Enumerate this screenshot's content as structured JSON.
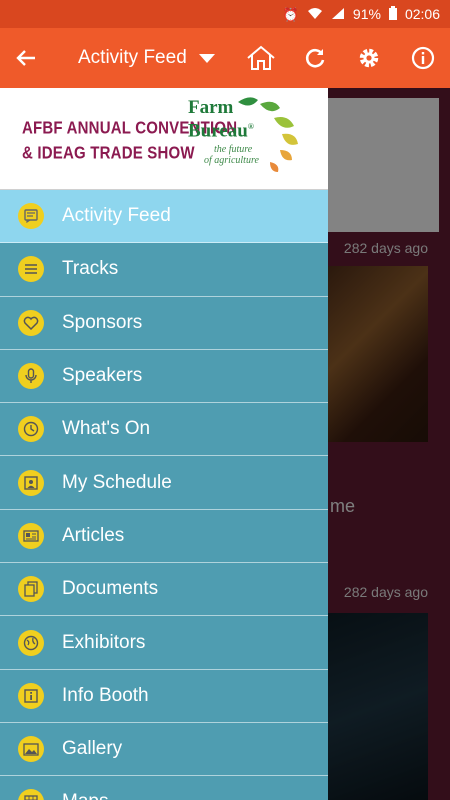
{
  "status_bar": {
    "battery": "91%",
    "time": "02:06"
  },
  "app_bar": {
    "title": "Activity Feed",
    "icons": [
      "back-arrow-icon",
      "dropdown-caret-icon",
      "home-icon",
      "refresh-icon",
      "gear-icon",
      "info-icon"
    ]
  },
  "drawer_header": {
    "convention_line1": "AFBF ANNUAL CONVENTION",
    "convention_line2": "& IDEAG TRADE SHOW",
    "partner_line1": "Farm",
    "partner_line2": "Bureau",
    "partner_mark": "®",
    "tagline_line1": "the future",
    "tagline_line2": "of agriculture"
  },
  "menu": [
    {
      "label": "Activity Feed",
      "icon": "feed-icon",
      "active": true
    },
    {
      "label": "Tracks",
      "icon": "list-icon"
    },
    {
      "label": "Sponsors",
      "icon": "heart-icon"
    },
    {
      "label": "Speakers",
      "icon": "microphone-icon"
    },
    {
      "label": "What's On",
      "icon": "clock-icon"
    },
    {
      "label": "My Schedule",
      "icon": "calendar-person-icon"
    },
    {
      "label": "Articles",
      "icon": "article-icon"
    },
    {
      "label": "Documents",
      "icon": "document-icon"
    },
    {
      "label": "Exhibitors",
      "icon": "globe-icon"
    },
    {
      "label": "Info Booth",
      "icon": "info-square-icon"
    },
    {
      "label": "Gallery",
      "icon": "image-icon"
    },
    {
      "label": "Maps",
      "icon": "map-icon"
    }
  ],
  "feed_background": {
    "post1_time": "282 days ago",
    "post2_partial_text": "me",
    "post2_time": "282 days ago"
  },
  "colors": {
    "app_bar": "#ef5a2a",
    "status_bar": "#d9471f",
    "drawer": "#4f9db1",
    "active_item": "#8ed6ee",
    "icon_circle": "#f0cf1f",
    "convention_text": "#8b1a50",
    "farm_bureau_text": "#1f7a3a"
  }
}
